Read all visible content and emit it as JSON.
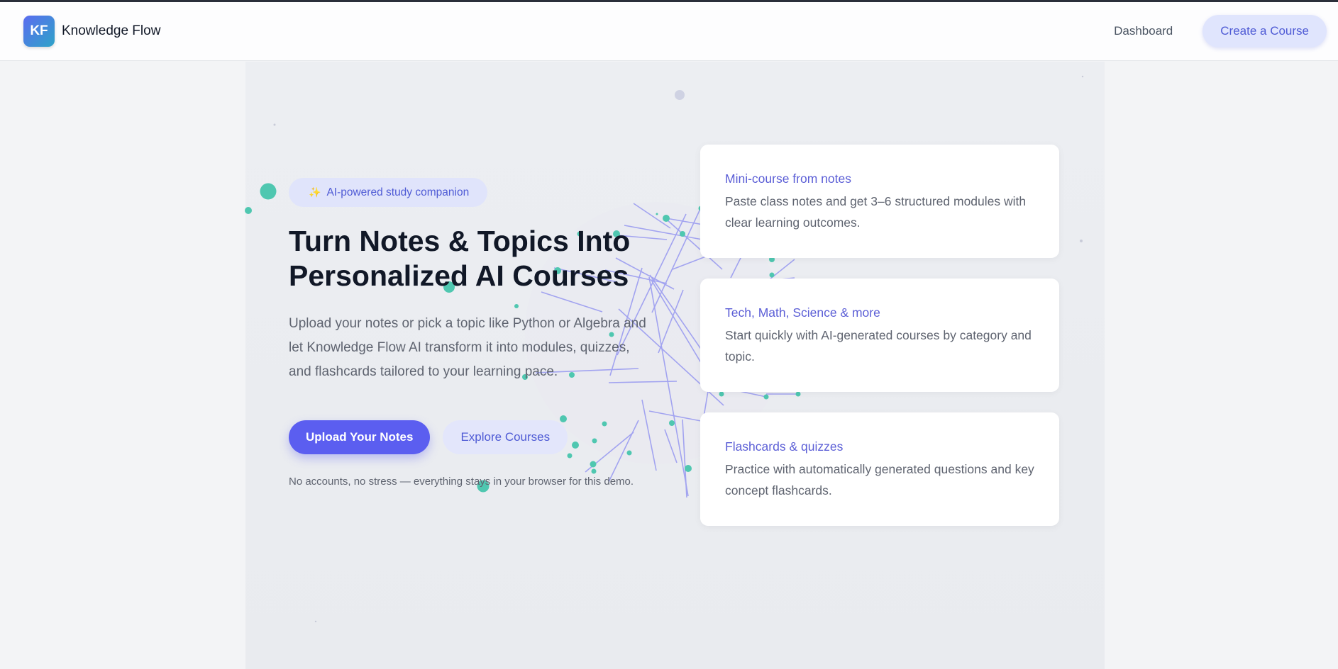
{
  "header": {
    "logo_text": "KF",
    "brand": "Knowledge Flow",
    "nav": {
      "dashboard": "Dashboard",
      "create": "Create a Course"
    }
  },
  "hero": {
    "badge_icon": "sparkle-icon",
    "badge": "AI-powered study companion",
    "title": "Turn Notes & Topics Into Personalized AI Courses",
    "lead": "Upload your notes or pick a topic like Python or Algebra and let Knowledge Flow AI transform it into modules, quizzes, and flashcards tailored to your learning pace.",
    "primary_cta": "Upload Your Notes",
    "secondary_cta": "Explore Courses",
    "note": "No accounts, no stress — everything stays in your browser for this demo."
  },
  "features": [
    {
      "title": "Mini-course from notes",
      "text": "Paste class notes and get 3–6 structured modules with clear learning outcomes."
    },
    {
      "title": "Tech, Math, Science & more",
      "text": "Start quickly with AI-generated courses by category and topic."
    },
    {
      "title": "Flashcards & quizzes",
      "text": "Practice with automatically generated questions and key concept flashcards."
    }
  ],
  "colors": {
    "accent": "#5b5ef0",
    "accent_soft": "#e0e4fb",
    "teal": "#4fc7b0",
    "line": "#7b7ef0",
    "heading": "#111827",
    "body": "#5f6470"
  }
}
